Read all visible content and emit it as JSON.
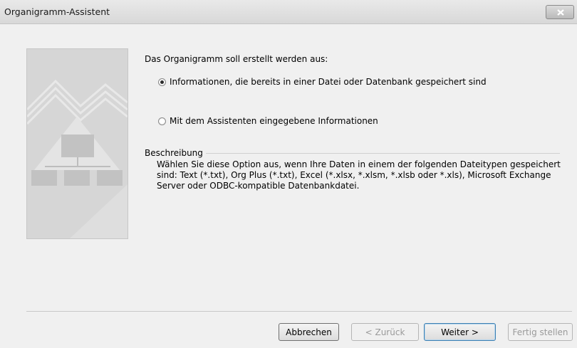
{
  "window": {
    "title": "Organigramm-Assistent"
  },
  "content": {
    "intro": "Das Organigramm soll erstellt werden aus:",
    "options": [
      {
        "label": "Informationen, die bereits in einer Datei oder Datenbank gespeichert sind",
        "selected": true
      },
      {
        "label": "Mit dem Assistenten eingegebene Informationen",
        "selected": false
      }
    ],
    "description_label": "Beschreibung",
    "description_text": "Wählen Sie diese Option aus, wenn Ihre Daten in einem der folgenden Dateitypen gespeichert sind: Text (*.txt), Org Plus (*.txt), Excel (*.xlsx, *.xlsm, *.xlsb oder *.xls), Microsoft Exchange Server oder ODBC-kompatible Datenbankdatei."
  },
  "buttons": {
    "cancel": "Abbrechen",
    "back": "< Zurück",
    "next": "Weiter >",
    "finish": "Fertig stellen"
  },
  "icons": {
    "close": "close-icon",
    "side_image": "org-chart-illustration"
  }
}
